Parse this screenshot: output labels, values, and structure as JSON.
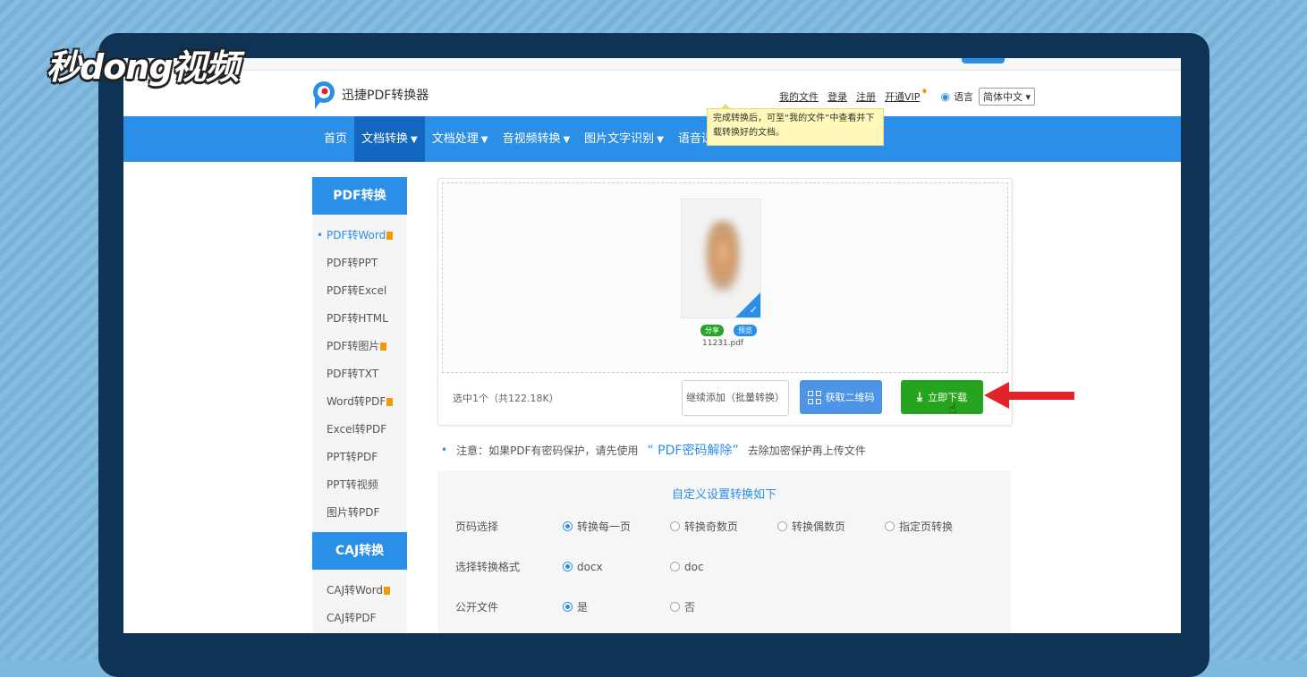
{
  "watermark": {
    "text": "秒dong视频"
  },
  "header": {
    "logo_text": "迅捷PDF转换器",
    "links": [
      "我的文件",
      "登录",
      "注册",
      "开通VIP"
    ],
    "vip_badge": "♦",
    "lang_label": "语言",
    "lang_value": "简体中文"
  },
  "tooltip": {
    "text": "完成转换后，可至“我的文件”中查看并下载转换好的文档。"
  },
  "nav": {
    "items": [
      {
        "label": "首页",
        "caret": ""
      },
      {
        "label": "文档转换",
        "caret": "▼"
      },
      {
        "label": "文档处理",
        "caret": "▼"
      },
      {
        "label": "音视频转换",
        "caret": "▼"
      },
      {
        "label": "图片文字识别",
        "caret": "▼"
      },
      {
        "label": "语音识别",
        "caret": "▼"
      }
    ]
  },
  "sidebar": {
    "pdf_header": "PDF转换",
    "pdf_items": [
      "PDF转Word",
      "PDF转PPT",
      "PDF转Excel",
      "PDF转HTML",
      "PDF转图片",
      "PDF转TXT",
      "Word转PDF",
      "Excel转PDF",
      "PPT转PDF",
      "PPT转视频",
      "图片转PDF"
    ],
    "caj_header": "CAJ转换",
    "caj_items": [
      "CAJ转Word",
      "CAJ转PDF"
    ]
  },
  "upload": {
    "share_label": "分享",
    "preview_label": "预览",
    "file_name": "11231.pdf",
    "selection_info": "选中1个（共122.18K）",
    "add_button": "继续添加（批量转换）",
    "qr_button": "获取二维码",
    "download_button": "立即下载"
  },
  "notice": {
    "prefix": "注意：如果PDF有密码保护，请先使用",
    "link": "“ PDF密码解除”",
    "suffix": "去除加密保护再上传文件"
  },
  "settings": {
    "title": "自定义设置转换如下",
    "page_label": "页码选择",
    "page_options": [
      "转换每一页",
      "转换奇数页",
      "转换偶数页",
      "指定页转换"
    ],
    "format_label": "选择转换格式",
    "format_options": [
      "docx",
      "doc"
    ],
    "public_label": "公开文件",
    "public_options": [
      "是",
      "否"
    ]
  },
  "colors": {
    "brand_blue": "#2b8fe8",
    "download_green": "#27a41d",
    "arrow_red": "#e2242a",
    "laptop_frame": "#0e3354"
  }
}
